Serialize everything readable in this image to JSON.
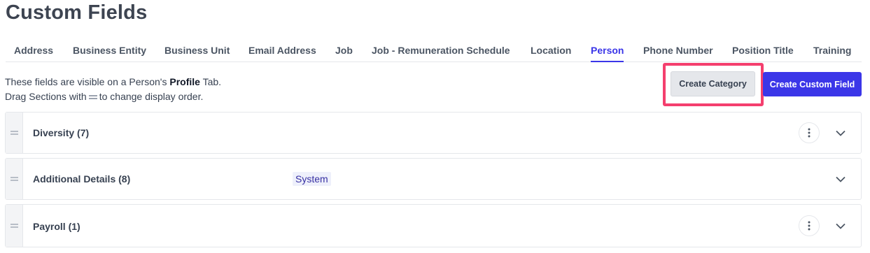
{
  "page": {
    "title": "Custom Fields"
  },
  "tabs": [
    {
      "label": "Address"
    },
    {
      "label": "Business Entity"
    },
    {
      "label": "Business Unit"
    },
    {
      "label": "Email Address"
    },
    {
      "label": "Job"
    },
    {
      "label": "Job - Remuneration Schedule"
    },
    {
      "label": "Location"
    },
    {
      "label": "Person",
      "active": true
    },
    {
      "label": "Phone Number"
    },
    {
      "label": "Position Title"
    },
    {
      "label": "Training"
    }
  ],
  "intro": {
    "line1_pre": "These fields are visible on a Person's ",
    "line1_bold": "Profile",
    "line1_post": " Tab.",
    "line2_pre": "Drag Sections with",
    "line2_post": "to change display order."
  },
  "actions": {
    "create_category": "Create Category",
    "create_custom_field": "Create Custom Field",
    "highlight_color": "#f43f6e",
    "accent_color": "#3b36e8"
  },
  "sections": [
    {
      "title": "Diversity (7)",
      "badge": "",
      "has_menu": true,
      "icons": [
        "drag-handle",
        "more-vertical",
        "chevron-down"
      ]
    },
    {
      "title": "Additional Details (8)",
      "badge": "System",
      "has_menu": false,
      "icons": [
        "drag-handle",
        "chevron-down"
      ]
    },
    {
      "title": "Payroll (1)",
      "badge": "",
      "has_menu": true,
      "icons": [
        "drag-handle",
        "more-vertical",
        "chevron-down"
      ]
    }
  ]
}
